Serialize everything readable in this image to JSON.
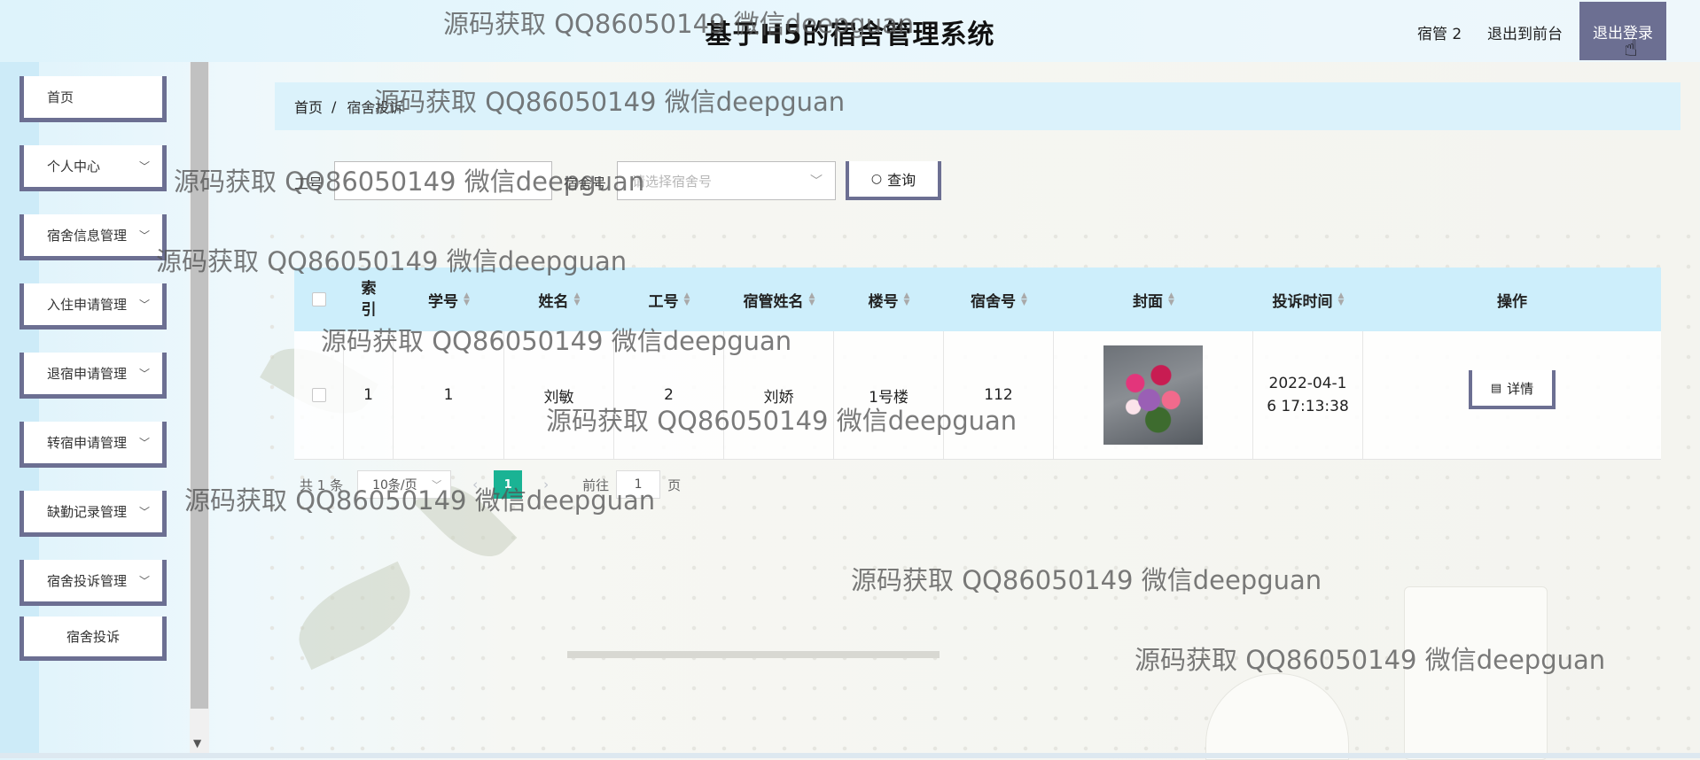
{
  "header": {
    "title": "基于H5的宿舍管理系统",
    "user": "宿管 2",
    "to_front": "退出到前台",
    "logout": "退出登录"
  },
  "sidebar": {
    "items": [
      {
        "label": "首页",
        "has_arrow": false
      },
      {
        "label": "个人中心",
        "has_arrow": true
      },
      {
        "label": "宿舍信息管理",
        "has_arrow": true
      },
      {
        "label": "入住申请管理",
        "has_arrow": true
      },
      {
        "label": "退宿申请管理",
        "has_arrow": true
      },
      {
        "label": "转宿申请管理",
        "has_arrow": true
      },
      {
        "label": "缺勤记录管理",
        "has_arrow": true
      },
      {
        "label": "宿舍投诉管理",
        "has_arrow": true
      }
    ],
    "subitem": "宿舍投诉"
  },
  "breadcrumb": {
    "home": "首页",
    "separator": "/",
    "current": "宿舍投诉"
  },
  "search": {
    "label_worker": "工号",
    "label_room": "宿舍号",
    "room_placeholder": "请选择宿舍号",
    "button": "查询"
  },
  "table": {
    "columns": [
      "索引",
      "学号",
      "姓名",
      "工号",
      "宿管姓名",
      "楼号",
      "宿舍号",
      "封面",
      "投诉时间",
      "操作"
    ],
    "rows": [
      {
        "index": "1",
        "student_no": "1",
        "name": "刘敏",
        "worker_no": "2",
        "manager_name": "刘娇",
        "building": "1号楼",
        "room": "112",
        "time": "2022-04-16 17:13:38",
        "action": "详情"
      }
    ]
  },
  "pagination": {
    "total": "共 1 条",
    "page_size": "10条/页",
    "current_page": "1",
    "goto_label": "前往",
    "goto_value": "1",
    "page_unit": "页"
  },
  "watermark": "源码获取 QQ86050149 微信deepguan",
  "colors": {
    "accent": "#6c6f92",
    "header_bg": "#def3fb",
    "table_head": "#cdeefb",
    "page_active": "#1ab394"
  }
}
